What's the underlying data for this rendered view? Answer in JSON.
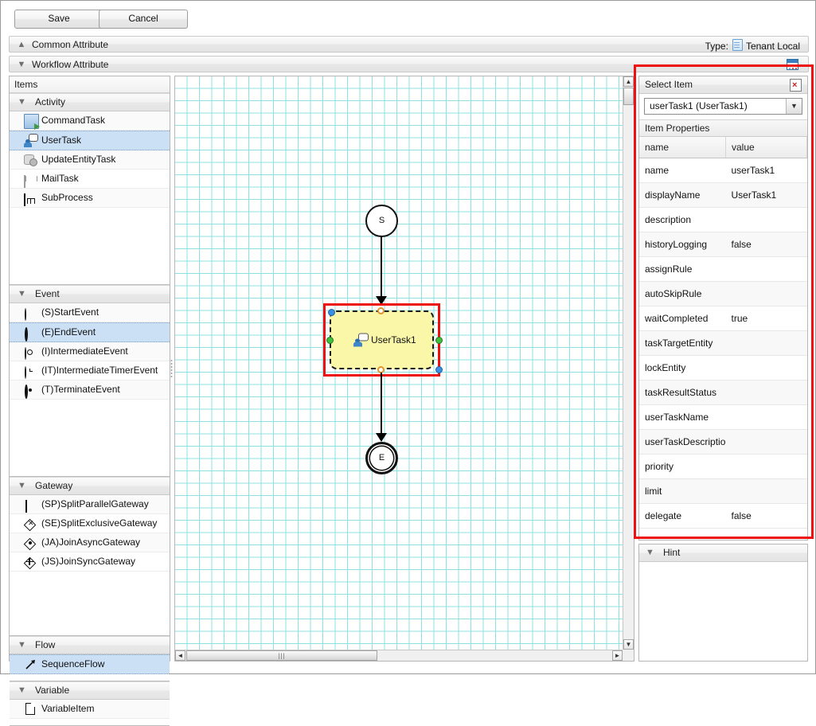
{
  "toolbar": {
    "save_label": "Save",
    "cancel_label": "Cancel"
  },
  "accordions": {
    "common": {
      "label": "Common Attribute",
      "chevron": "chevron-up-icon"
    },
    "workflow": {
      "label": "Workflow Attribute",
      "chevron": "chevron-down-icon"
    }
  },
  "type_info": {
    "label": "Type:",
    "value": "Tenant Local",
    "icon": "document-icon"
  },
  "items_panel": {
    "title": "Items",
    "groups": [
      {
        "label": "Activity",
        "items": [
          {
            "label": "CommandTask",
            "icon": "command-task-icon",
            "selected": false
          },
          {
            "label": "UserTask",
            "icon": "user-task-icon",
            "selected": true
          },
          {
            "label": "UpdateEntityTask",
            "icon": "update-entity-task-icon",
            "selected": false
          },
          {
            "label": "MailTask",
            "icon": "mail-task-icon",
            "selected": false
          },
          {
            "label": "SubProcess",
            "icon": "sub-process-icon",
            "selected": false
          }
        ]
      },
      {
        "label": "Event",
        "items": [
          {
            "label": "(S)StartEvent",
            "icon": "start-event-icon",
            "selected": false
          },
          {
            "label": "(E)EndEvent",
            "icon": "end-event-icon",
            "selected": true
          },
          {
            "label": "(I)IntermediateEvent",
            "icon": "intermediate-event-icon",
            "selected": false
          },
          {
            "label": "(IT)IntermediateTimerEvent",
            "icon": "intermediate-timer-event-icon",
            "selected": false
          },
          {
            "label": "(T)TerminateEvent",
            "icon": "terminate-event-icon",
            "selected": false
          }
        ]
      },
      {
        "label": "Gateway",
        "items": [
          {
            "label": "(SP)SplitParallelGateway",
            "icon": "split-parallel-gateway-icon",
            "selected": false
          },
          {
            "label": "(SE)SplitExclusiveGateway",
            "icon": "split-exclusive-gateway-icon",
            "selected": false
          },
          {
            "label": "(JA)JoinAsyncGateway",
            "icon": "join-async-gateway-icon",
            "selected": false
          },
          {
            "label": "(JS)JoinSyncGateway",
            "icon": "join-sync-gateway-icon",
            "selected": false
          }
        ]
      },
      {
        "label": "Flow",
        "items": [
          {
            "label": "SequenceFlow",
            "icon": "sequence-flow-icon",
            "selected": true
          }
        ]
      },
      {
        "label": "Variable",
        "items": [
          {
            "label": "VariableItem",
            "icon": "variable-item-icon",
            "selected": false
          }
        ]
      }
    ]
  },
  "canvas": {
    "nodes": [
      {
        "id": "start",
        "label": "S",
        "type": "start-event"
      },
      {
        "id": "userTask1",
        "label": "UserTask1",
        "type": "user-task",
        "selected": true
      },
      {
        "id": "end",
        "label": "E",
        "type": "end-event"
      }
    ],
    "grid_color": "#8fe0e0",
    "node_fill": "#faf8a8",
    "selection_color": "#ee1111"
  },
  "right_panel": {
    "select_item": {
      "header": "Select Item",
      "delete_icon": "delete-item-icon",
      "selected_value": "userTask1 (UserTask1)"
    },
    "item_properties": {
      "header": "Item Properties",
      "columns": [
        "name",
        "value"
      ],
      "rows": [
        {
          "name": "name",
          "value": "userTask1"
        },
        {
          "name": "displayName",
          "value": "UserTask1"
        },
        {
          "name": "description",
          "value": ""
        },
        {
          "name": "historyLogging",
          "value": "false"
        },
        {
          "name": "assignRule",
          "value": ""
        },
        {
          "name": "autoSkipRule",
          "value": ""
        },
        {
          "name": "waitCompleted",
          "value": "true"
        },
        {
          "name": "taskTargetEntity",
          "value": ""
        },
        {
          "name": "lockEntity",
          "value": ""
        },
        {
          "name": "taskResultStatus",
          "value": ""
        },
        {
          "name": "userTaskName",
          "value": ""
        },
        {
          "name": "userTaskDescriptior",
          "value": ""
        },
        {
          "name": "priority",
          "value": ""
        },
        {
          "name": "limit",
          "value": ""
        },
        {
          "name": "delegate",
          "value": "false"
        }
      ]
    },
    "hint": {
      "header": "Hint",
      "body": ""
    }
  },
  "scrollbars": {
    "h_left_arrow": "◄",
    "h_right_arrow": "►",
    "v_up_arrow": "▲",
    "v_down_arrow": "▼",
    "grip": "|||"
  }
}
